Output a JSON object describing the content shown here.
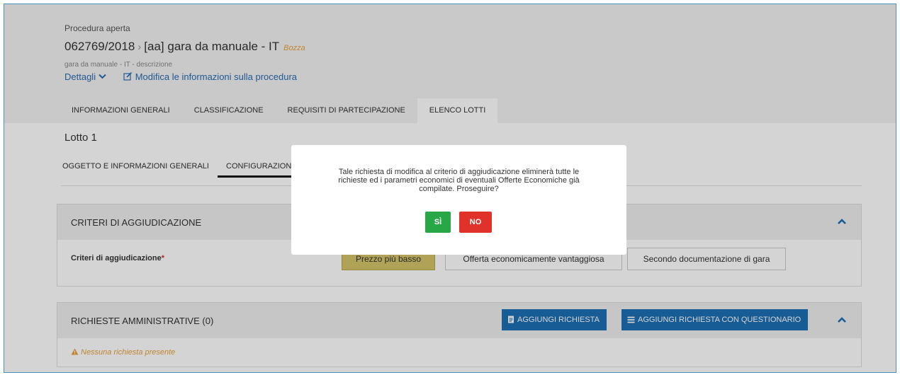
{
  "header": {
    "procedure_type": "Procedura aperta",
    "code": "062769/2018",
    "name": "[aa] gara da manuale - IT",
    "status": "Bozza",
    "description": "gara da manuale - IT - descrizione",
    "details_link": "Dettagli",
    "edit_link": "Modifica le informazioni sulla procedura"
  },
  "tabs": [
    {
      "label": "INFORMAZIONI GENERALI"
    },
    {
      "label": "CLASSIFICAZIONE"
    },
    {
      "label": "REQUISITI DI PARTECIPAZIONE"
    },
    {
      "label": "ELENCO LOTTI",
      "active": true
    }
  ],
  "lot": {
    "title": "Lotto 1",
    "subtabs": [
      {
        "label": "OGGETTO E INFORMAZIONI GENERALI"
      },
      {
        "label": "CONFIGURAZIONE OF",
        "active": true
      }
    ]
  },
  "criteria_panel": {
    "title": "CRITERI DI AGGIUDICAZIONE",
    "field_label": "Criteri di aggiudicazione",
    "required_mark": "*",
    "options": [
      {
        "label": "Prezzo più basso",
        "selected": true
      },
      {
        "label": "Offerta economicamente vantaggiosa",
        "selected": false
      },
      {
        "label": "Secondo documentazione di gara",
        "selected": false
      }
    ]
  },
  "admin_panel": {
    "title": "RICHIESTE AMMINISTRATIVE (0)",
    "add_button": "AGGIUNGI RICHIESTA",
    "add_questionnaire_button": "AGGIUNGI RICHIESTA CON QUESTIONARIO",
    "empty_message": "Nessuna richiesta presente"
  },
  "modal": {
    "message": "Tale richiesta di modifica al criterio di aggiudicazione eliminerà tutte le richieste ed i parametri economici di eventuali Offerte Economiche già compilate. Proseguire?",
    "yes_label": "SÌ",
    "no_label": "NO"
  },
  "colors": {
    "primary": "#1e6fb5",
    "yes": "#27a745",
    "no": "#e0322a",
    "selected_option": "#d4c56a",
    "warning": "#e6a23c"
  },
  "icons": [
    "chevron-down-icon",
    "edit-icon",
    "chevron-up-icon",
    "document-icon",
    "list-icon",
    "warning-icon"
  ]
}
